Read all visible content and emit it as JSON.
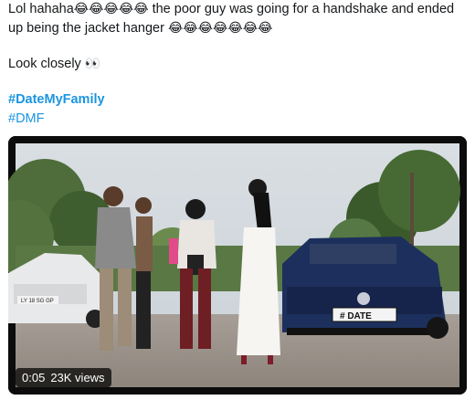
{
  "tweet": {
    "line1_text_a": "Lol hahaha",
    "line1_emoji": "😂😂😂😂😂",
    "line1_text_b": " the poor guy was going for a handshake and ended",
    "line2_text": "up being the jacket hanger ",
    "line2_emoji": "😂😂😂😂😂😂😂",
    "line3_text": "Look closely ",
    "line3_emoji": "👀",
    "hashtag1": "#DateMyFamily",
    "hashtag2": "#DMF"
  },
  "video": {
    "time": "0:05",
    "views": "23K views",
    "plate_text": "# DATE",
    "front_plate_text": "LY 18 SG GP"
  },
  "colors": {
    "hashtag": "#1b95e0",
    "car": "#1d2f5c"
  }
}
